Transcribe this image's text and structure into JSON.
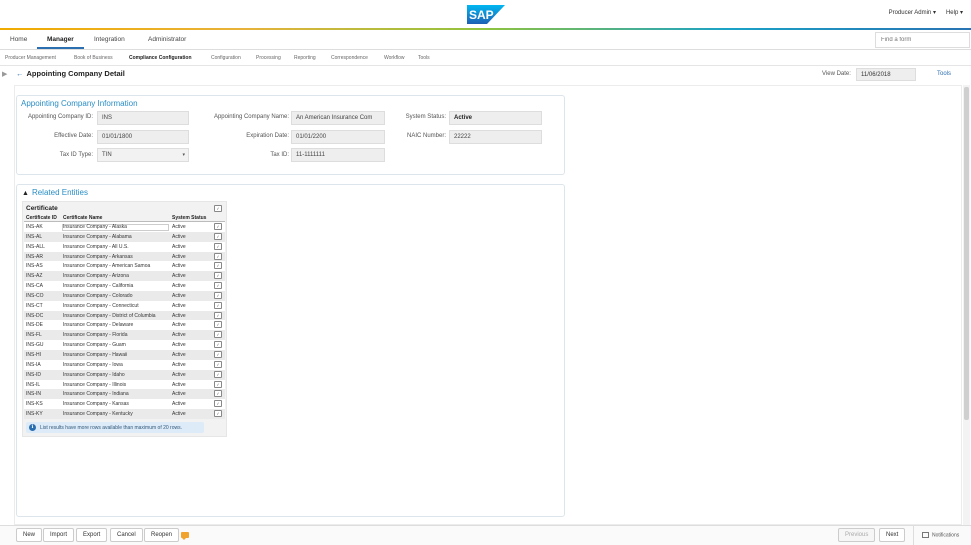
{
  "header": {
    "logo_text": "SAP",
    "user_menu": "Producer Admin",
    "help_menu": "Help"
  },
  "main_tabs": [
    {
      "label": "Home"
    },
    {
      "label": "Manager",
      "active": true
    },
    {
      "label": "Integration"
    },
    {
      "label": "Administrator"
    }
  ],
  "search": {
    "placeholder": "Find a form"
  },
  "sub_tabs": [
    {
      "label": "Producer Management"
    },
    {
      "label": "Book of Business"
    },
    {
      "label": "Compliance Configuration",
      "active": true
    },
    {
      "label": "Configuration"
    },
    {
      "label": "Processing"
    },
    {
      "label": "Reporting"
    },
    {
      "label": "Correspondence"
    },
    {
      "label": "Workflow"
    },
    {
      "label": "Tools"
    }
  ],
  "page": {
    "title": "Appointing Company Detail",
    "view_date_label": "View Date:",
    "view_date": "11/06/2018",
    "tools_link": "Tools"
  },
  "info_section": {
    "title": "Appointing Company Information",
    "appointing_company_id_label": "Appointing Company ID:",
    "appointing_company_id": "INS",
    "appointing_company_name_label": "Appointing Company Name:",
    "appointing_company_name": "An American Insurance Com",
    "system_status_label": "System Status:",
    "system_status": "Active",
    "effective_date_label": "Effective Date:",
    "effective_date": "01/01/1800",
    "expiration_date_label": "Expiration Date:",
    "expiration_date": "01/01/2200",
    "naic_number_label": "NAIC Number:",
    "naic_number": "22222",
    "tax_id_type_label": "Tax ID Type:",
    "tax_id_type": "TIN",
    "tax_id_label": "Tax ID:",
    "tax_id": "11-1111111"
  },
  "related": {
    "title": "Related Entities",
    "certificate_header": "Certificate",
    "columns": [
      "Certificate ID",
      "Certificate Name",
      "System Status"
    ],
    "rows": [
      {
        "id": "INS-AK",
        "name": "Insurance Company - Alaska",
        "status": "Active"
      },
      {
        "id": "INS-AL",
        "name": "Insurance Company - Alabama",
        "status": "Active"
      },
      {
        "id": "INS-ALL",
        "name": "Insurance Company - All U.S.",
        "status": "Active"
      },
      {
        "id": "INS-AR",
        "name": "Insurance Company - Arkansas",
        "status": "Active"
      },
      {
        "id": "INS-AS",
        "name": "Insurance Company - American Samoa",
        "status": "Active"
      },
      {
        "id": "INS-AZ",
        "name": "Insurance Company - Arizona",
        "status": "Active"
      },
      {
        "id": "INS-CA",
        "name": "Insurance Company - California",
        "status": "Active"
      },
      {
        "id": "INS-CO",
        "name": "Insurance Company - Colorado",
        "status": "Active"
      },
      {
        "id": "INS-CT",
        "name": "Insurance Company - Connecticut",
        "status": "Active"
      },
      {
        "id": "INS-DC",
        "name": "Insurance Company - District of Columbia",
        "status": "Active"
      },
      {
        "id": "INS-DE",
        "name": "Insurance Company - Delaware",
        "status": "Active"
      },
      {
        "id": "INS-FL",
        "name": "Insurance Company - Florida",
        "status": "Active"
      },
      {
        "id": "INS-GU",
        "name": "Insurance Company - Guam",
        "status": "Active"
      },
      {
        "id": "INS-HI",
        "name": "Insurance Company - Hawaii",
        "status": "Active"
      },
      {
        "id": "INS-IA",
        "name": "Insurance Company - Iowa",
        "status": "Active"
      },
      {
        "id": "INS-ID",
        "name": "Insurance Company - Idaho",
        "status": "Active"
      },
      {
        "id": "INS-IL",
        "name": "Insurance Company - Illinois",
        "status": "Active"
      },
      {
        "id": "INS-IN",
        "name": "Insurance Company - Indiana",
        "status": "Active"
      },
      {
        "id": "INS-KS",
        "name": "Insurance Company - Kansas",
        "status": "Active"
      },
      {
        "id": "INS-KY",
        "name": "Insurance Company - Kentucky",
        "status": "Active"
      }
    ],
    "info_message": "List results have more rows available than maximum of 20 rows."
  },
  "footer": {
    "new": "New",
    "import": "Import",
    "export": "Export",
    "cancel": "Cancel",
    "reopen": "Reopen",
    "previous": "Previous",
    "next": "Next",
    "notifications": "Notifications"
  }
}
